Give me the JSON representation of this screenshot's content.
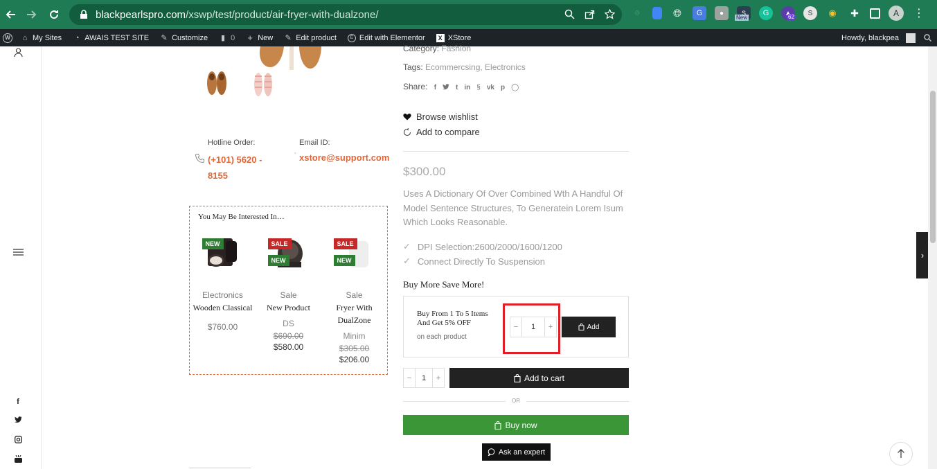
{
  "browser": {
    "url_domain": "blackpearlspro.com",
    "url_path": "/xswp/test/product/air-fryer-with-dualzone/",
    "ext_new_label": "New",
    "ext_count": "62",
    "avatar_letter": "A"
  },
  "admin_bar": {
    "my_sites": "My Sites",
    "site_name": "AWAIS TEST SITE",
    "customize": "Customize",
    "comments_count": "0",
    "new": "New",
    "edit_product": "Edit product",
    "edit_elementor": "Edit with Elementor",
    "xstore": "XStore",
    "howdy": "Howdy, blackpea"
  },
  "product": {
    "category_label": "Category:",
    "category_value": "Fashion",
    "tags_label": "Tags:",
    "tags_value": "Ecommercsing, Electronics",
    "share_label": "Share:",
    "share_icons": [
      "facebook-icon",
      "twitter-icon",
      "tumblr-icon",
      "linkedin-icon",
      "skype-icon",
      "vk-icon",
      "pinterest-icon",
      "whatsapp-icon"
    ],
    "wishlist": "Browse wishlist",
    "compare": "Add to compare",
    "price": "$300.00",
    "description": "Uses A Dictionary Of Over Combined Wth A Handful Of Model Sentence Structures, To Generatein Lorem Isum Which Looks Reasonable.",
    "features": [
      "DPI Selection:2600/2000/1600/1200",
      "Connect Directly To Suspension"
    ]
  },
  "contact": {
    "hotline_label": "Hotline Order:",
    "hotline_value": "(+101) 5620 - 8155",
    "email_label": "Email ID:",
    "email_value": "xstore@support.com"
  },
  "interest": {
    "title": "You May Be Interested In…",
    "cards": [
      {
        "badges": [
          "NEW"
        ],
        "category": "Electronics",
        "name": "Wooden Classical",
        "sub": "",
        "old_price": "",
        "price": "$760.00"
      },
      {
        "badges": [
          "SALE",
          "NEW"
        ],
        "category": "Sale",
        "name": "New Product",
        "sub": "DS",
        "old_price": "$690.00",
        "price": "$580.00"
      },
      {
        "badges": [
          "SALE",
          "NEW"
        ],
        "category": "Sale",
        "name": "Fryer With DualZone",
        "sub": "Minim",
        "old_price": "$305.00",
        "price": "$206.00"
      }
    ]
  },
  "bulk": {
    "title": "Buy More Save More!",
    "offer": "Buy From 1 To 5 Items And Get 5% OFF",
    "sub": "on each product",
    "qty": "1",
    "add_label": "Add"
  },
  "cart": {
    "qty": "1",
    "add_to_cart": "Add to cart",
    "or": "OR",
    "buy_now": "Buy now",
    "ask_expert": "Ask an expert"
  },
  "colors": {
    "accent": "#e06636",
    "buy_green": "#3b9637",
    "badge_new": "#2e7d32",
    "badge_sale": "#c62828",
    "highlight": "#e01e25"
  }
}
